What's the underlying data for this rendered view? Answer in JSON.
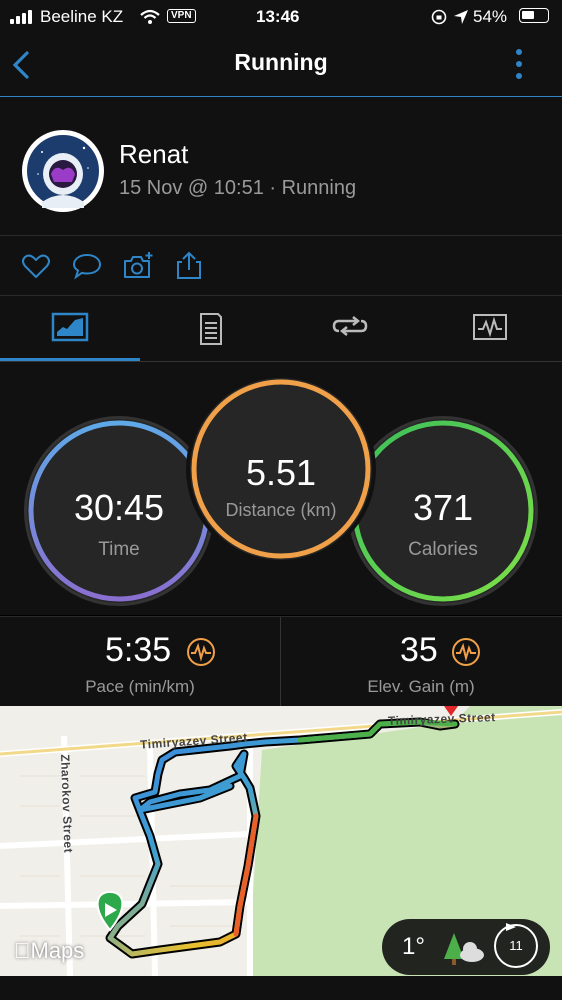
{
  "status_bar": {
    "carrier": "Beeline KZ",
    "vpn": "VPN",
    "time": "13:46",
    "battery": "54%",
    "battery_fraction": 0.54
  },
  "nav": {
    "title": "Running"
  },
  "profile": {
    "name": "Renat",
    "subtitle": "15 Nov @ 10:51 · Running"
  },
  "metrics": {
    "time": {
      "value": "30:45",
      "label": "Time",
      "color": "#5fa8e8"
    },
    "distance": {
      "value": "5.51",
      "label": "Distance (km)",
      "color": "#f0a048"
    },
    "calories": {
      "value": "371",
      "label": "Calories",
      "color": "#4fcf4a"
    }
  },
  "stats": {
    "pace": {
      "value": "5:35",
      "label": "Pace (min/km)"
    },
    "elevation": {
      "value": "35",
      "label": "Elev. Gain (m)"
    }
  },
  "map": {
    "streets": [
      "Timiryazev Street",
      "Timiryazev Street",
      "Zharokov Street"
    ],
    "attribution": "Maps",
    "weather_temp": "1°",
    "wind_speed": "11"
  },
  "colors": {
    "accent": "#2e86c8",
    "orange": "#f0a048",
    "background": "#111111"
  }
}
